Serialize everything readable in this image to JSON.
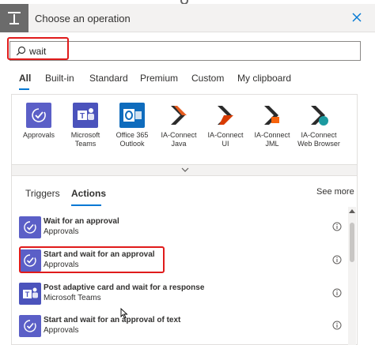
{
  "header": {
    "title": "Choose an operation"
  },
  "search": {
    "value": "wait",
    "placeholder": ""
  },
  "tabs": [
    {
      "label": "All"
    },
    {
      "label": "Built-in"
    },
    {
      "label": "Standard"
    },
    {
      "label": "Premium"
    },
    {
      "label": "Custom"
    },
    {
      "label": "My clipboard"
    }
  ],
  "connectors": [
    {
      "line1": "Approvals",
      "line2": ""
    },
    {
      "line1": "Microsoft",
      "line2": "Teams"
    },
    {
      "line1": "Office 365",
      "line2": "Outlook"
    },
    {
      "line1": "IA-Connect",
      "line2": "Java"
    },
    {
      "line1": "IA-Connect",
      "line2": "UI"
    },
    {
      "line1": "IA-Connect",
      "line2": "JML"
    },
    {
      "line1": "IA-Connect",
      "line2": "Web Browser"
    }
  ],
  "subtabs": {
    "triggers": "Triggers",
    "actions": "Actions",
    "see_more": "See more"
  },
  "actions": [
    {
      "name": "Wait for an approval",
      "connector": "Approvals"
    },
    {
      "name": "Start and wait for an approval",
      "connector": "Approvals"
    },
    {
      "name": "Post adaptive card and wait for a response",
      "connector": "Microsoft Teams"
    },
    {
      "name": "Start and wait for an approval of text",
      "connector": "Approvals"
    }
  ],
  "colors": {
    "approvals": "#5b5fc7",
    "teams": "#4b53bc",
    "outlook": "#0f6cbd",
    "ia_connect_java": "#e65c1f",
    "ia_connect_ui": "#d83b01",
    "ia_connect_jml": "#f7630c",
    "ia_connect_web": "#1b9aa0",
    "highlight": "#e01b1b",
    "accent": "#0078d4"
  }
}
